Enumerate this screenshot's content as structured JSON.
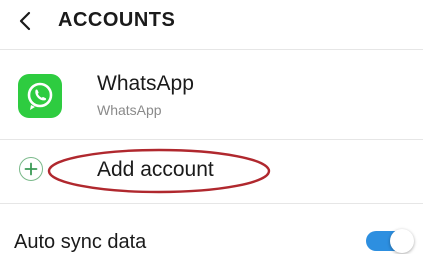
{
  "header": {
    "back_icon": "chevron-left-icon",
    "title": "ACCOUNTS"
  },
  "accounts": [
    {
      "name": "WhatsApp",
      "subtitle": "WhatsApp",
      "icon": "whatsapp-icon",
      "icon_color": "#2ecc40"
    }
  ],
  "add_account": {
    "icon": "plus-circle-icon",
    "label": "Add account",
    "highlight_color": "#b0282e"
  },
  "auto_sync": {
    "label": "Auto sync data",
    "enabled": true,
    "toggle_color": "#2d8fe0"
  }
}
